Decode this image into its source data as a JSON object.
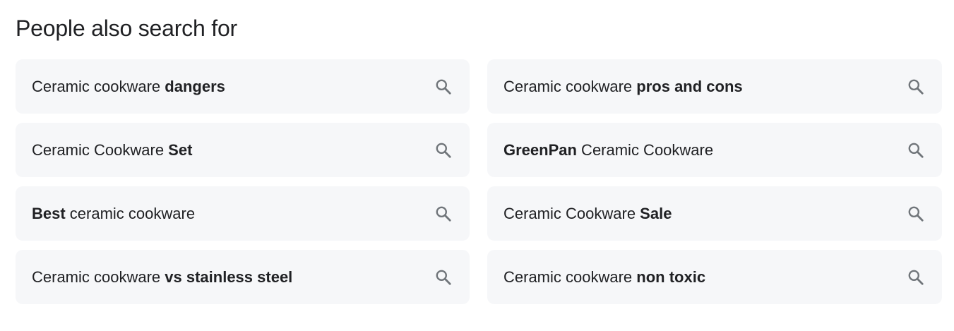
{
  "section": {
    "title": "People also search for"
  },
  "suggestions": [
    {
      "parts": [
        {
          "text": "Ceramic cookware ",
          "bold": false
        },
        {
          "text": "dangers",
          "bold": true
        }
      ]
    },
    {
      "parts": [
        {
          "text": "Ceramic cookware ",
          "bold": false
        },
        {
          "text": "pros and cons",
          "bold": true
        }
      ]
    },
    {
      "parts": [
        {
          "text": "Ceramic Cookware ",
          "bold": false
        },
        {
          "text": "Set",
          "bold": true
        }
      ]
    },
    {
      "parts": [
        {
          "text": "GreenPan",
          "bold": true
        },
        {
          "text": " Ceramic Cookware",
          "bold": false
        }
      ]
    },
    {
      "parts": [
        {
          "text": "Best",
          "bold": true
        },
        {
          "text": " ceramic cookware",
          "bold": false
        }
      ]
    },
    {
      "parts": [
        {
          "text": "Ceramic Cookware ",
          "bold": false
        },
        {
          "text": "Sale",
          "bold": true
        }
      ]
    },
    {
      "parts": [
        {
          "text": "Ceramic cookware ",
          "bold": false
        },
        {
          "text": "vs stainless steel",
          "bold": true
        }
      ]
    },
    {
      "parts": [
        {
          "text": "Ceramic cookware ",
          "bold": false
        },
        {
          "text": "non toxic",
          "bold": true
        }
      ]
    }
  ],
  "icons": {
    "suggestion_icon": "search-icon",
    "icon_color": "#70757a"
  },
  "colors": {
    "chip_background": "#f6f7f9",
    "text": "#202124"
  }
}
